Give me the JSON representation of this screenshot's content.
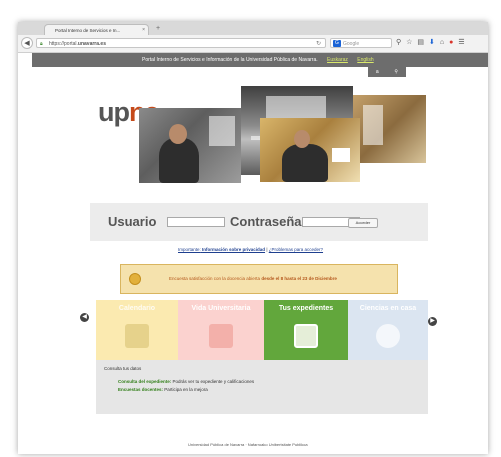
{
  "browser": {
    "tab_title": "Portal Interno de Servicios e In...",
    "tab_close": "×",
    "new_tab": "+",
    "url_prefix": "https://portal.",
    "url_domain": "unavarra.es",
    "search_placeholder": "Google",
    "search_engine": "G"
  },
  "site": {
    "topbar_text": "Portal Interno de Servicios e Información de la Universidad Pública de Navarra.",
    "lang_euskara": "Euskaraz",
    "lang_english": "English",
    "logo_up": "up",
    "logo_na": "na",
    "logo_sub": "Universidad Pública de Navarra · Nafarroako Unibertsitate Publikoa"
  },
  "login": {
    "user_label": "Usuario",
    "password_label": "Contraseña",
    "submit_label": "Acceder"
  },
  "links": {
    "privacy_prefix": "Importante:",
    "privacy_link": "Información sobre privacidad",
    "separator": "|",
    "problems_link": "¿Problemas para acceder?"
  },
  "notice": {
    "text_prefix": "Encuesta satisfacción con la docencia abierta",
    "text_dates": "desde el 8 hasta el 23 de Diciembre"
  },
  "carousel": {
    "prev": "◀",
    "next": "▶",
    "tiles": [
      {
        "title": "Calendario"
      },
      {
        "title": "Vida Universitaria"
      },
      {
        "title": "Tus expedientes"
      },
      {
        "title": "Ciencias en casa"
      }
    ]
  },
  "info": {
    "heading": "Consulta tus datos",
    "line1_key": "Consulta del expediente:",
    "line1_val": "Podrás ver tu expediente y calificaciones",
    "line2_key": "Encuestas docentes:",
    "line2_val": "Participa en la mejora"
  },
  "footer": "Universidad Pública de Navarra · Nafarroako Unibertsitate Publikoa"
}
